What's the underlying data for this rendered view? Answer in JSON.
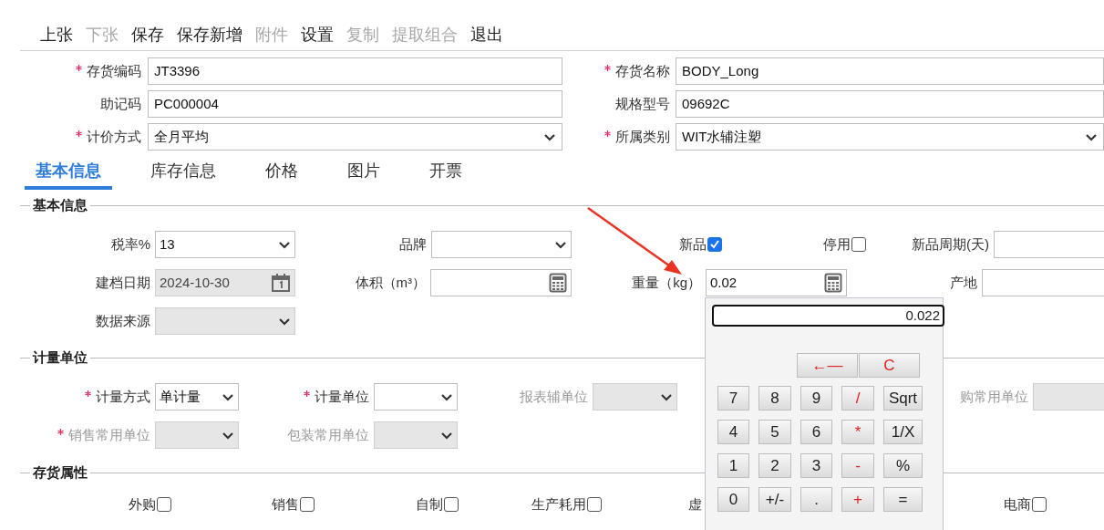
{
  "toolbar": [
    {
      "label": "上张",
      "disabled": false
    },
    {
      "label": "下张",
      "disabled": true
    },
    {
      "label": "保存",
      "disabled": false
    },
    {
      "label": "保存新增",
      "disabled": false
    },
    {
      "label": "附件",
      "disabled": true
    },
    {
      "label": "设置",
      "disabled": false
    },
    {
      "label": "复制",
      "disabled": true
    },
    {
      "label": "提取组合",
      "disabled": true
    },
    {
      "label": "退出",
      "disabled": false
    }
  ],
  "header_fields": [
    {
      "label": "存货编码",
      "required": true,
      "kind": "text",
      "value": "JT3396"
    },
    {
      "label": "存货名称",
      "required": true,
      "kind": "text",
      "value": "BODY_Long"
    },
    {
      "label": "助记码",
      "required": false,
      "kind": "text",
      "value": "PC000004"
    },
    {
      "label": "规格型号",
      "required": false,
      "kind": "text",
      "value": "09692C"
    },
    {
      "label": "计价方式",
      "required": true,
      "kind": "select",
      "value": "全月平均"
    },
    {
      "label": "所属类别",
      "required": true,
      "kind": "select",
      "value": "WIT水辅注塑"
    }
  ],
  "tabs": [
    {
      "label": "基本信息",
      "selected": true
    },
    {
      "label": "库存信息",
      "selected": false
    },
    {
      "label": "价格",
      "selected": false
    },
    {
      "label": "图片",
      "selected": false
    },
    {
      "label": "开票",
      "selected": false
    }
  ],
  "sections": [
    {
      "title": "基本信息",
      "fields": [
        {
          "kind": "select",
          "label": "税率%",
          "value": "13",
          "required": false,
          "disabled": false
        },
        {
          "kind": "select",
          "label": "品牌",
          "required": false,
          "disabled": false
        },
        {
          "kind": "checkbox",
          "label": "新品",
          "checked": true
        },
        {
          "kind": "checkbox",
          "label": "停用",
          "checked": false
        },
        {
          "kind": "text",
          "label": "新品周期(天)",
          "required": false,
          "disabled": false
        },
        {
          "kind": "date",
          "label": "建档日期",
          "value": "2024-10-30",
          "required": false,
          "disabled": true
        },
        {
          "kind": "calc",
          "label": "体积（m³）",
          "required": false,
          "disabled": false
        },
        {
          "kind": "calc",
          "label": "重量（kg）",
          "value": "0.02",
          "required": false,
          "disabled": false
        },
        {
          "kind": "text",
          "label": "产地",
          "required": false,
          "disabled": false
        },
        {
          "kind": "select",
          "label": "数据来源",
          "required": false,
          "disabled": true
        }
      ]
    },
    {
      "title": "计量单位",
      "fields": [
        {
          "kind": "select",
          "label": "计量方式",
          "value": "单计量",
          "required": true,
          "disabled": false
        },
        {
          "kind": "select",
          "label": "计量单位",
          "required": true,
          "disabled": false
        },
        {
          "kind": "select",
          "label": "报表辅单位",
          "required": false,
          "disabled": true
        },
        {
          "kind": "select",
          "label": "购常用单位",
          "required": false,
          "disabled": true
        },
        {
          "kind": "select",
          "label": "销售常用单位",
          "required": true,
          "disabled": true
        },
        {
          "kind": "select",
          "label": "包装常用单位",
          "required": false,
          "disabled": true
        }
      ]
    },
    {
      "title": "存货属性",
      "fields": [
        {
          "kind": "checkbox",
          "label": "外购",
          "checked": false
        },
        {
          "kind": "checkbox",
          "label": "销售",
          "checked": false
        },
        {
          "kind": "checkbox",
          "label": "自制",
          "checked": false
        },
        {
          "kind": "checkbox",
          "label": "生产耗用",
          "checked": false
        },
        {
          "kind": "covered",
          "label": "虚"
        },
        {
          "kind": "checkbox",
          "label": "电商",
          "checked": false
        }
      ]
    }
  ],
  "calculator": {
    "display": "0.022",
    "edit_keys": [
      {
        "label": "←—",
        "kind": "operator"
      },
      {
        "label": "C",
        "kind": "operator"
      }
    ],
    "keys": [
      {
        "label": "7",
        "kind": "digit"
      },
      {
        "label": "8",
        "kind": "digit"
      },
      {
        "label": "9",
        "kind": "digit"
      },
      {
        "label": "/",
        "kind": "operator"
      },
      {
        "label": "Sqrt",
        "kind": "function"
      },
      {
        "label": "4",
        "kind": "digit"
      },
      {
        "label": "5",
        "kind": "digit"
      },
      {
        "label": "6",
        "kind": "digit"
      },
      {
        "label": "*",
        "kind": "operator"
      },
      {
        "label": "1/X",
        "kind": "function"
      },
      {
        "label": "1",
        "kind": "digit"
      },
      {
        "label": "2",
        "kind": "digit"
      },
      {
        "label": "3",
        "kind": "digit"
      },
      {
        "label": "-",
        "kind": "operator"
      },
      {
        "label": "%",
        "kind": "function"
      },
      {
        "label": "0",
        "kind": "digit"
      },
      {
        "label": "+/-",
        "kind": "function"
      },
      {
        "label": ".",
        "kind": "digit"
      },
      {
        "label": "+",
        "kind": "operator"
      },
      {
        "label": "=",
        "kind": "function"
      }
    ]
  }
}
